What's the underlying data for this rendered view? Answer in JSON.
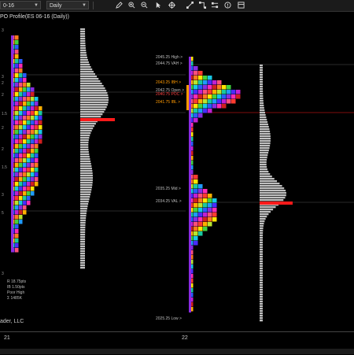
{
  "toolbar": {
    "instrument_value": "0-16",
    "interval_value": "Daily",
    "icons": [
      "pencil-icon",
      "zoom-in-icon",
      "zoom-out-icon",
      "cursor-icon",
      "global-crosshair-icon",
      "drawing-tools-icon",
      "strategy-icon",
      "properties-icon",
      "data-box-icon",
      "template-icon"
    ]
  },
  "chart": {
    "title": "PO Profile(ES 06-16 (Daily))",
    "left_profile_labels": [
      "3",
      "3",
      "2",
      "2",
      "1.5",
      "2",
      "2",
      "1.5",
      "3",
      "5",
      "3"
    ],
    "right_labels": [
      {
        "text": "2045.25 High >",
        "color": "#bbbbbb"
      },
      {
        "text": "2044.75 VAH >",
        "color": "#bbbbbb"
      },
      {
        "text": "2043.25 IBH >",
        "color": "#ff9900"
      },
      {
        "text": "2042.75 Open >",
        "color": "#bbbbbb"
      },
      {
        "text": "2041.75 IBL >",
        "color": "#ff9900"
      },
      {
        "text": "2040.75 POC >",
        "color": "#ff4040"
      },
      {
        "text": "2035.25 Mid >",
        "color": "#bbbbbb"
      },
      {
        "text": "2034.25 VAL >",
        "color": "#bbbbbb"
      },
      {
        "text": "2025.25 Low >",
        "color": "#bbbbbb"
      }
    ],
    "stats": [
      "R 18.75pts",
      "IB 1.50pts",
      "Poor High",
      "Σ 1485K"
    ],
    "copyright": "ader, LLC"
  },
  "time_axis": {
    "labels": [
      "21",
      "22"
    ]
  },
  "colors": {
    "poc": "#ff1a1a",
    "ib": "#ff9900",
    "reference": "#555555",
    "volume": "#bfbfbf",
    "volume_va": "#e0e0e0"
  }
}
